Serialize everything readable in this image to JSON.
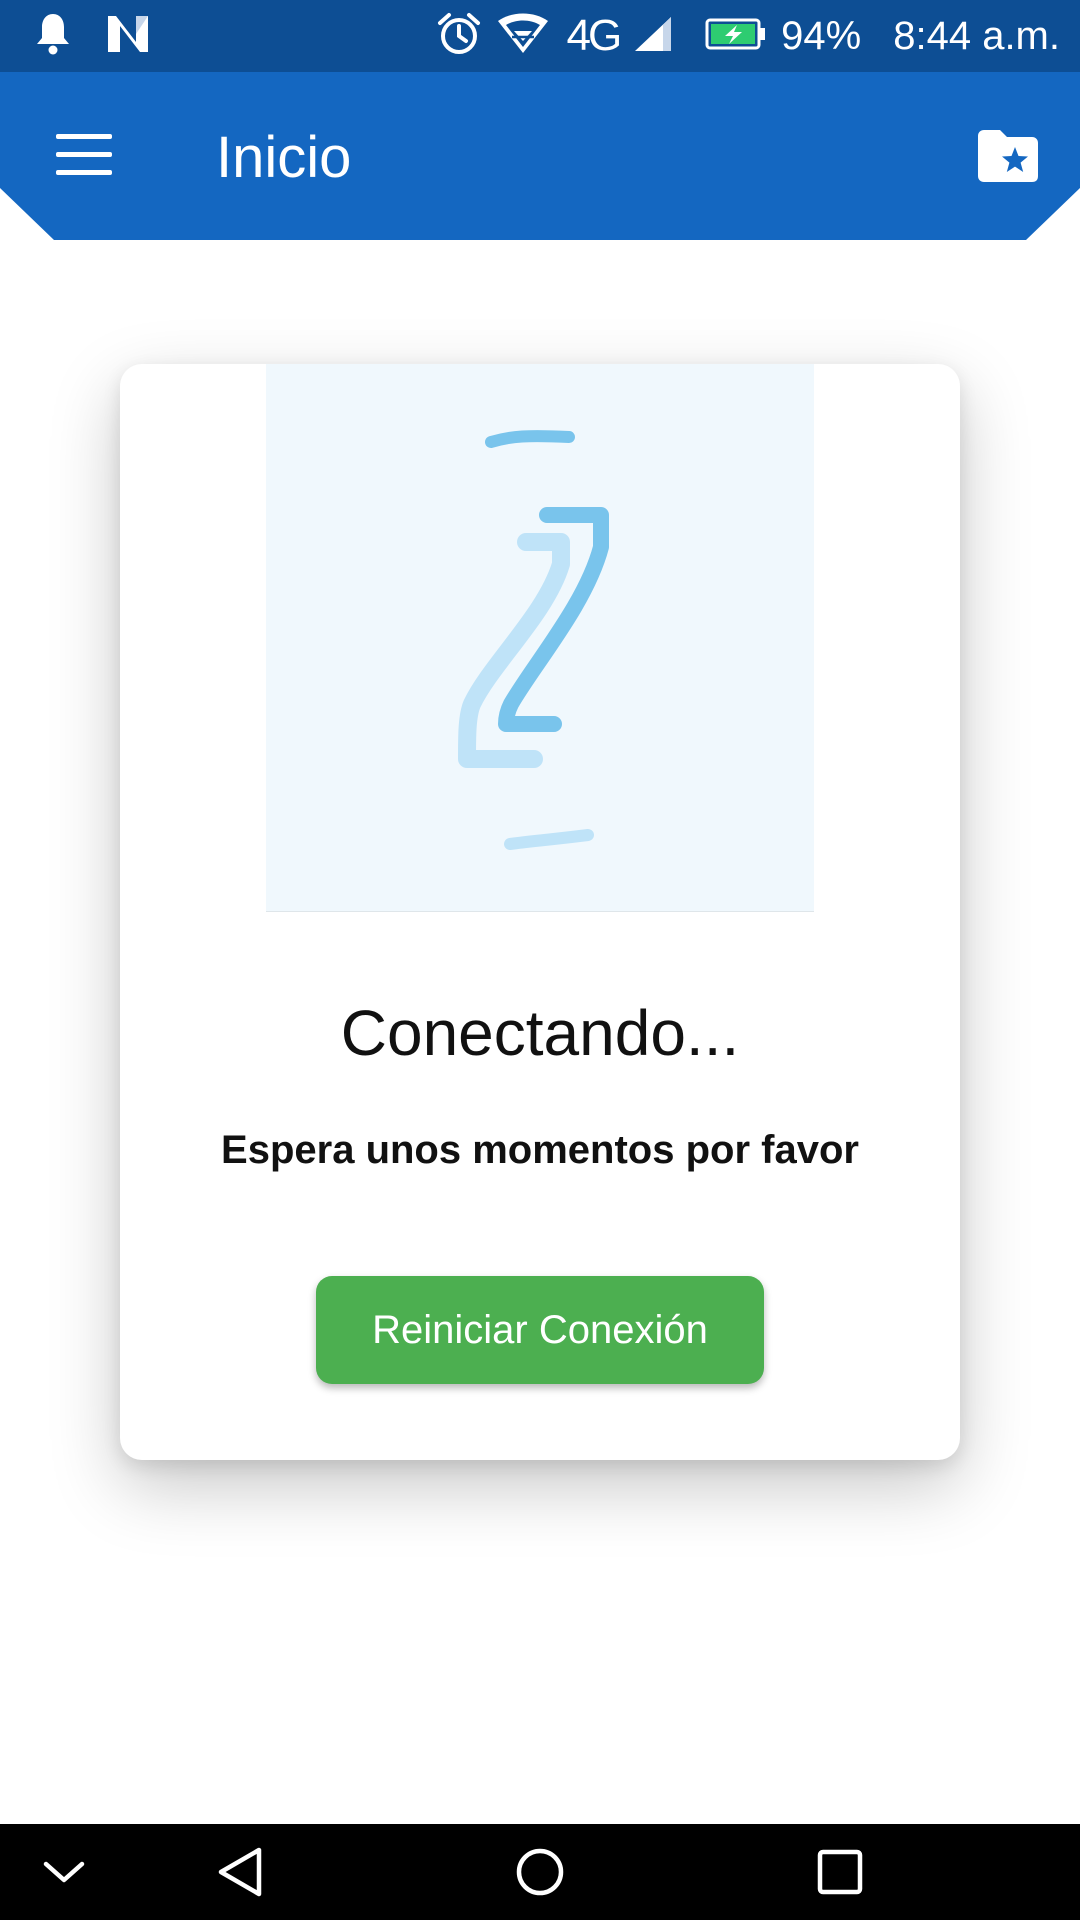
{
  "status_bar": {
    "network": "4G",
    "battery": "94%",
    "time": "8:44 a.m."
  },
  "app_bar": {
    "title": "Inicio"
  },
  "card": {
    "heading": "Conectando...",
    "message": "Espera unos momentos por favor",
    "button_label": "Reiniciar Conexión"
  },
  "colors": {
    "status_bar": "#0d4e94",
    "app_bar": "#1467c1",
    "button": "#4caf50",
    "loader_bg": "#f0f8fd",
    "logo_light": "#bfe3f8",
    "logo_dark": "#79c4ec"
  },
  "icons": {
    "status_left": [
      "notification-bell-icon",
      "n-app-icon"
    ],
    "status_right": [
      "alarm-icon",
      "wifi-icon",
      "signal-icon",
      "battery-charging-icon"
    ],
    "app_bar": [
      "menu-icon",
      "starred-folder-icon"
    ],
    "nav": [
      "collapse-chevron-icon",
      "back-icon",
      "home-icon",
      "recents-icon"
    ]
  }
}
